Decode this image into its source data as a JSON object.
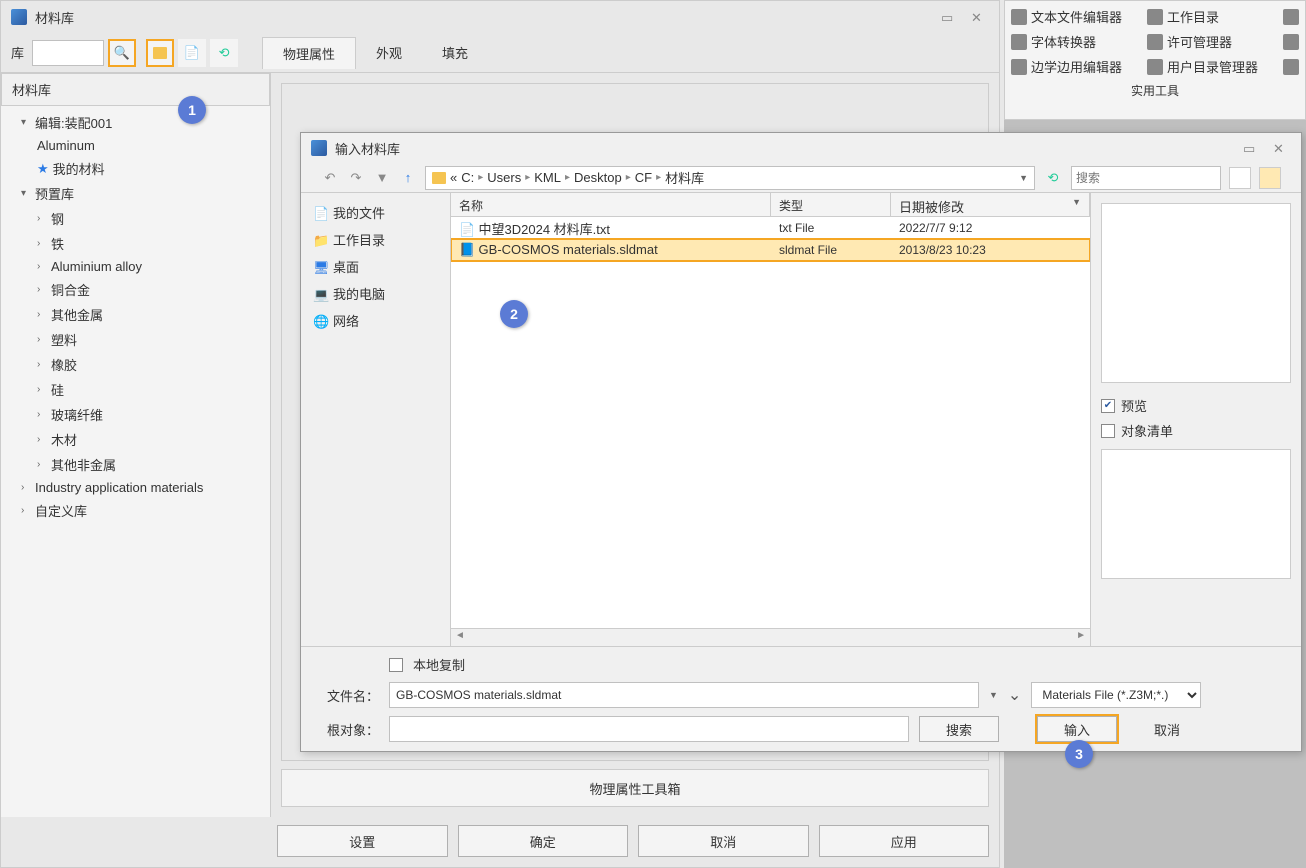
{
  "window": {
    "title": "材料库"
  },
  "toolbar": {
    "lib_label": "库"
  },
  "tabs": {
    "physical": "物理属性",
    "appearance": "外观",
    "fill": "填充"
  },
  "tree": {
    "header": "材料库",
    "edit_assembly": "编辑:装配001",
    "aluminum": "Aluminum",
    "my_materials": "我的材料",
    "preset_lib": "预置库",
    "steel": "钢",
    "iron": "铁",
    "aluminium_alloy": "Aluminium alloy",
    "copper_alloy": "铜合金",
    "other_metal": "其他金属",
    "plastic": "塑料",
    "rubber": "橡胶",
    "silicon": "硅",
    "glass_fiber": "玻璃纤维",
    "wood": "木材",
    "other_nonmetal": "其他非金属",
    "industry_app": "Industry application materials",
    "custom_lib": "自定义库"
  },
  "props_toolbox": "物理属性工具箱",
  "buttons": {
    "settings": "设置",
    "ok": "确定",
    "cancel": "取消",
    "apply": "应用"
  },
  "ribbon": {
    "text_editor": "文本文件编辑器",
    "work_dir": "工作目录",
    "font_converter": "字体转换器",
    "license_mgr": "许可管理器",
    "edge_editor": "边学边用编辑器",
    "user_dir_mgr": "用户目录管理器",
    "footer": "实用工具"
  },
  "dialog": {
    "title": "输入材料库",
    "breadcrumb": {
      "drive": "C:",
      "p1": "Users",
      "p2": "KML",
      "p3": "Desktop",
      "p4": "CF",
      "p5": "材料库"
    },
    "search_placeholder": "搜索",
    "nav": {
      "my_docs": "我的文件",
      "work_dir": "工作目录",
      "desktop": "桌面",
      "my_computer": "我的电脑",
      "network": "网络"
    },
    "cols": {
      "name": "名称",
      "type": "类型",
      "modified": "日期被修改"
    },
    "files": [
      {
        "name": "中望3D2024 材料库.txt",
        "type": "txt File",
        "date": "2022/7/7 9:12"
      },
      {
        "name": "GB-COSMOS materials.sldmat",
        "type": "sldmat File",
        "date": "2013/8/23 10:23"
      }
    ],
    "preview_label": "预览",
    "object_list": "对象清单",
    "local_copy": "本地复制",
    "filename_label": "文件名：",
    "filename_value": "GB-COSMOS materials.sldmat",
    "root_obj_label": "根对象：",
    "search_btn": "搜索",
    "filter": "Materials File (*.Z3M;*.)",
    "import_btn": "输入",
    "cancel_btn": "取消"
  },
  "callouts": {
    "c1": "1",
    "c2": "2",
    "c3": "3"
  }
}
